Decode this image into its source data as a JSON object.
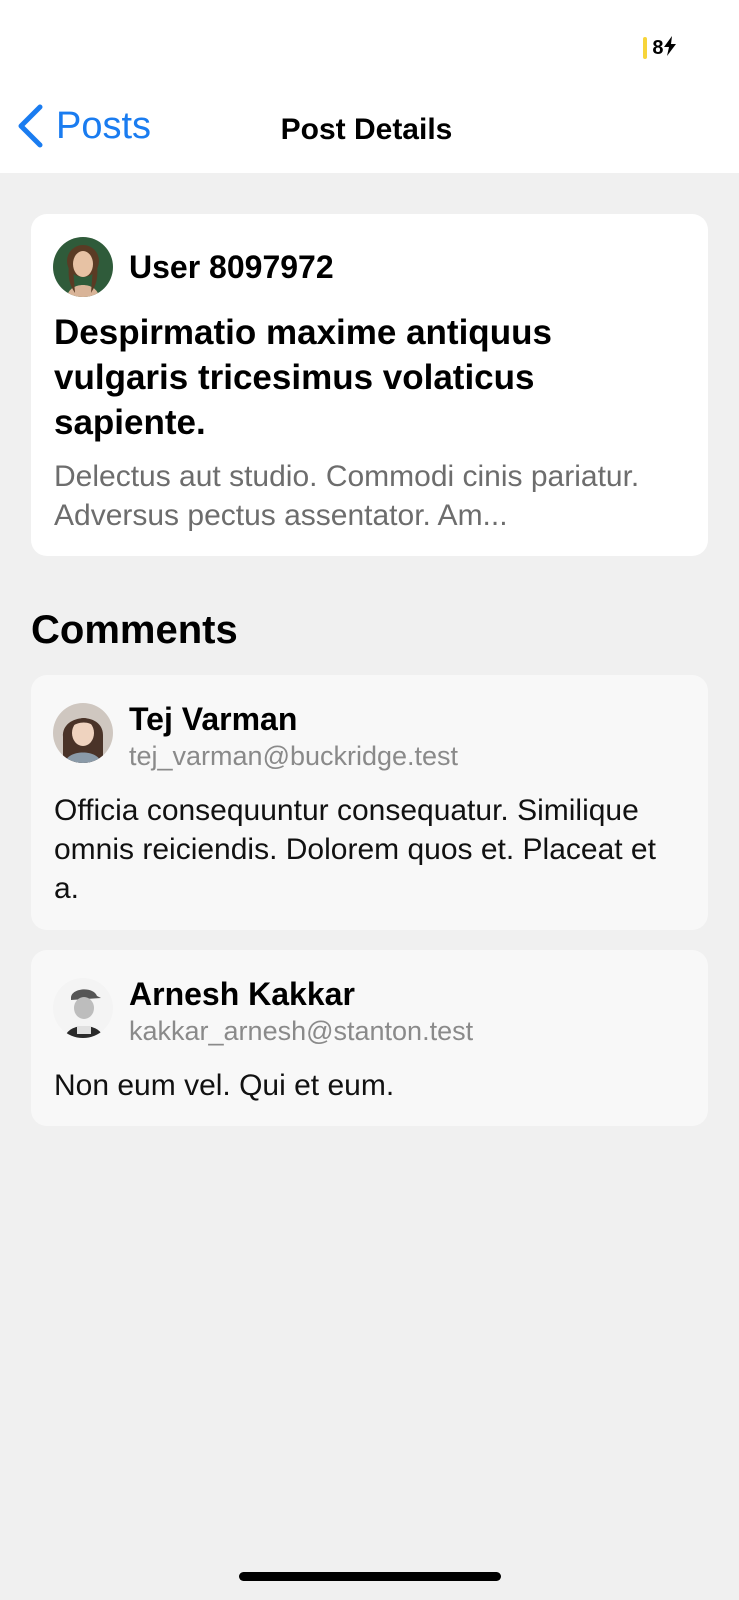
{
  "status_bar": {
    "battery": "8"
  },
  "nav": {
    "back_label": "Posts",
    "title": "Post Details"
  },
  "post": {
    "author": "User 8097972",
    "title": "Despirmatio maxime antiquus vulgaris tricesimus volaticus sapiente.",
    "body": "Delectus aut studio. Commodi cinis pariatur. Adversus pectus assentator. Am..."
  },
  "comments_section": {
    "title": "Comments"
  },
  "comments": [
    {
      "name": "Tej Varman",
      "email": "tej_varman@buckridge.test",
      "body": "Officia consequuntur consequatur. Similique omnis reiciendis. Dolorem quos et. Placeat et a."
    },
    {
      "name": "Arnesh Kakkar",
      "email": "kakkar_arnesh@stanton.test",
      "body": "Non eum vel. Qui et eum."
    }
  ],
  "colors": {
    "accent": "#1a7cf0",
    "battery": "#f7d53a",
    "background": "#f0f0f0"
  }
}
